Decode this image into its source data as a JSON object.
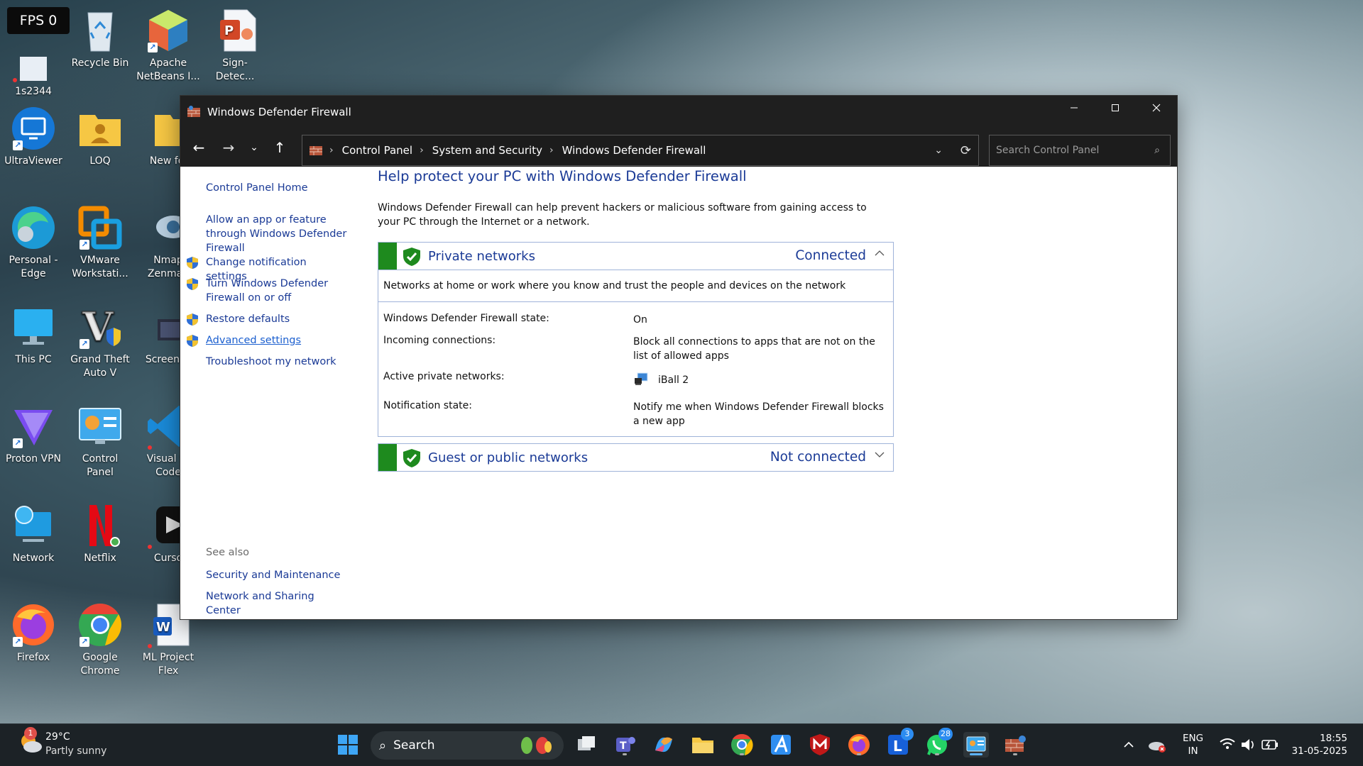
{
  "overlay": {
    "fps": "FPS 0"
  },
  "desktop": {
    "icons": [
      {
        "label": "1s2344"
      },
      {
        "label": "Recycle Bin"
      },
      {
        "label": "Apache NetBeans I..."
      },
      {
        "label": "Sign-Detec..."
      },
      {
        "label": "UltraViewer"
      },
      {
        "label": "LOQ"
      },
      {
        "label": "New fol"
      },
      {
        "label": "Personal - Edge"
      },
      {
        "label": "VMware Workstati..."
      },
      {
        "label": "Nmap Zenmap"
      },
      {
        "label": "This PC"
      },
      {
        "label": "Grand Theft Auto V"
      },
      {
        "label": "Screensh"
      },
      {
        "label": "Proton VPN"
      },
      {
        "label": "Control Panel"
      },
      {
        "label": "Visual St Code"
      },
      {
        "label": "Network"
      },
      {
        "label": "Netflix"
      },
      {
        "label": "Curso"
      },
      {
        "label": "Firefox"
      },
      {
        "label": "Google Chrome"
      },
      {
        "label": "ML Project Flex"
      }
    ]
  },
  "window": {
    "title": "Windows Defender Firewall",
    "breadcrumb": [
      "Control Panel",
      "System and Security",
      "Windows Defender Firewall"
    ],
    "search_placeholder": "Search Control Panel",
    "sidebar": {
      "links": [
        "Control Panel Home",
        "Allow an app or feature through Windows Defender Firewall",
        "Change notification settings",
        "Turn Windows Defender Firewall on or off",
        "Restore defaults",
        "Advanced settings",
        "Troubleshoot my network"
      ],
      "see_also_label": "See also",
      "see_also": [
        "Security and Maintenance",
        "Network and Sharing Center"
      ]
    },
    "main": {
      "heading": "Help protect your PC with Windows Defender Firewall",
      "intro": "Windows Defender Firewall can help prevent hackers or malicious software from gaining access to your PC through the Internet or a network.",
      "private": {
        "title": "Private networks",
        "status": "Connected",
        "description": "Networks at home or work where you know and trust the people and devices on the network",
        "rows": [
          {
            "label": "Windows Defender Firewall state:",
            "value": "On"
          },
          {
            "label": "Incoming connections:",
            "value": "Block all connections to apps that are not on the list of allowed apps"
          },
          {
            "label": "Active private networks:",
            "value": "iBall 2"
          },
          {
            "label": "Notification state:",
            "value": "Notify me when Windows Defender Firewall blocks a new app"
          }
        ]
      },
      "public": {
        "title": "Guest or public networks",
        "status": "Not connected"
      }
    }
  },
  "taskbar": {
    "weather_temp": "29°C",
    "weather_desc": "Partly sunny",
    "weather_badge": "1",
    "search_label": "Search",
    "teams_badge": "3",
    "whatsapp_badge": "28",
    "lang_top": "ENG",
    "lang_bottom": "IN",
    "time": "18:55",
    "date": "31-05-2025"
  },
  "colors": {
    "link": "#1a3a96",
    "green": "#1e8a1e",
    "titlebar": "#1f1f1f"
  }
}
